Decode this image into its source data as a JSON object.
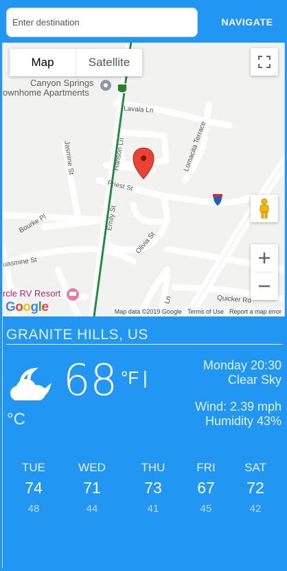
{
  "search": {
    "placeholder": "Enter destination",
    "value": ""
  },
  "navigate_label": "NAVIGATE",
  "map": {
    "type_buttons": [
      "Map",
      "Satellite"
    ],
    "active_type": "Map",
    "streets": {
      "lavala": "Lavala Ln",
      "hanson": "Hanson Ln",
      "lomacita": "Lomacita Terrace",
      "jasmine": "Jasmine St",
      "priest": "Priest St",
      "bourke": "Bourke Pl",
      "emily": "Emily St",
      "olivia": "Olivia St",
      "quasmine": "uasmine St",
      "quicker": "Quicker Rd",
      "ln": "Ln"
    },
    "poi": {
      "canyon_1": "Canyon Springs",
      "canyon_2": "ownhome Apartments",
      "rv": "rcle RV Resort"
    },
    "route_shield": "8",
    "logo": "Google",
    "attribution": {
      "data": "Map data ©2019 Google",
      "terms": "Terms of Use",
      "report": "Report a map error"
    }
  },
  "weather": {
    "location": "GRANITE HILLS, US",
    "temp": "68",
    "unit_f": "°F",
    "unit_sep": "|",
    "unit_c": "°C",
    "datetime": "Monday 20:30",
    "condition": "Clear Sky",
    "wind": "Wind: 2.39 mph",
    "humidity": "Humidity 43%",
    "icon": "partly-cloudy-night-icon",
    "forecast": [
      {
        "day": "TUE",
        "hi": "74",
        "lo": "48"
      },
      {
        "day": "WED",
        "hi": "71",
        "lo": "44"
      },
      {
        "day": "THU",
        "hi": "73",
        "lo": "41"
      },
      {
        "day": "FRI",
        "hi": "67",
        "lo": "45"
      },
      {
        "day": "SAT",
        "hi": "72",
        "lo": "42"
      }
    ]
  },
  "colors": {
    "accent": "#2196f3",
    "marker": "#e53935",
    "route_line": "#1e8e3e",
    "interstate": "#4285f4"
  }
}
